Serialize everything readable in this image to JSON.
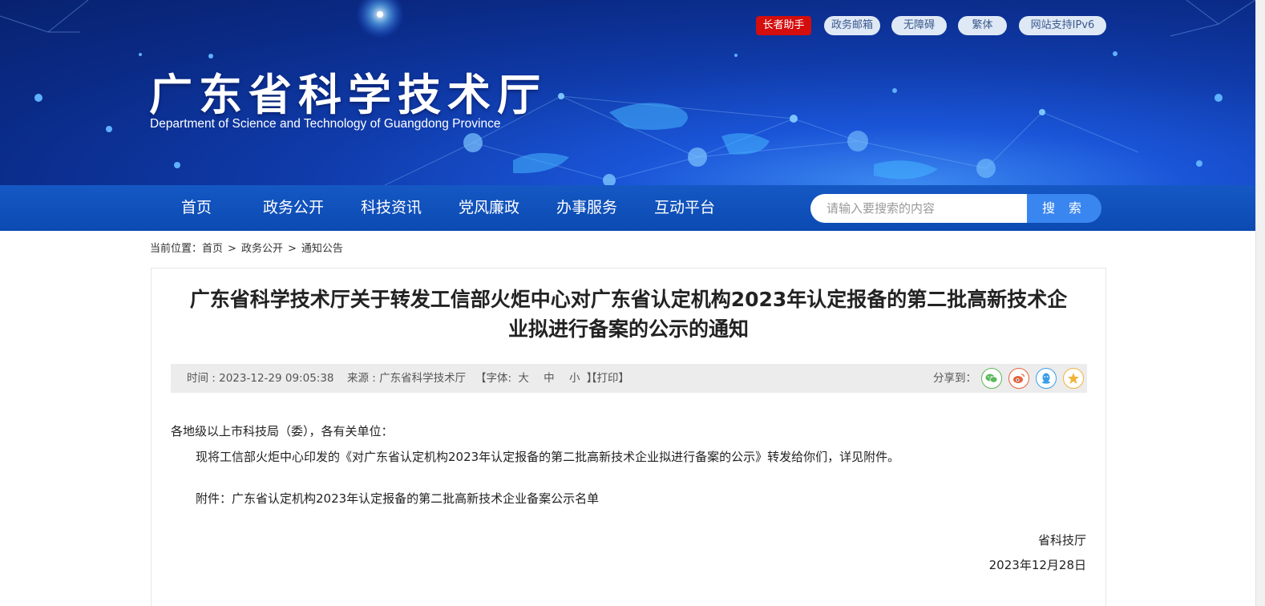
{
  "header": {
    "title": "广东省科学技术厅",
    "subtitle": "Department of Science and Technology of Guangdong Province",
    "top_links": [
      {
        "label": "长者助手"
      },
      {
        "label": "政务邮箱"
      },
      {
        "label": "无障碍"
      },
      {
        "label": "繁体"
      },
      {
        "label": "网站支持IPv6"
      }
    ]
  },
  "nav": {
    "items": [
      {
        "label": "首页"
      },
      {
        "label": "政务公开"
      },
      {
        "label": "科技资讯"
      },
      {
        "label": "党风廉政"
      },
      {
        "label": "办事服务"
      },
      {
        "label": "互动平台"
      }
    ],
    "search_placeholder": "请输入要搜索的内容",
    "search_button": "搜 索"
  },
  "breadcrumb": {
    "prefix": "当前位置：",
    "items": [
      "首页",
      "政务公开",
      "通知公告"
    ],
    "separator": ">"
  },
  "article": {
    "title_line1": "广东省科学技术厅关于转发工信部火炬中心对广东省认定机构2023年认定报备的第二批高新技术企",
    "title_line2": "业拟进行备案的公示的通知",
    "time": "时间 : 2023-12-29 09:05:38",
    "source": "来源 : 广东省科学技术厅",
    "font_label": "【字体:",
    "font_large": "大",
    "font_medium": "中",
    "font_small": "小",
    "font_close": "】",
    "print": "【打印】",
    "share_label": "分享到：",
    "share_icons": [
      "wechat-icon",
      "weibo-icon",
      "qq-icon",
      "qzone-icon"
    ],
    "salutation": "各地级以上市科技局（委），各有关单位：",
    "paragraph": "现将工信部火炬中心印发的《对广东省认定机构2023年认定报备的第二批高新技术企业拟进行备案的公示》转发给你们，详见附件。",
    "attachment": "附件：广东省认定机构2023年认定报备的第二批高新技术企业备案公示名单",
    "signature": "省科技厅",
    "date": "2023年12月28日"
  },
  "colors": {
    "nav_bg": "#1558c4",
    "search_button": "#3a86f0",
    "elder_button": "#d40d0d",
    "wechat": "#5cb85c",
    "weibo": "#e8623a",
    "qq": "#3a9ee8",
    "qzone": "#f0b43a"
  }
}
